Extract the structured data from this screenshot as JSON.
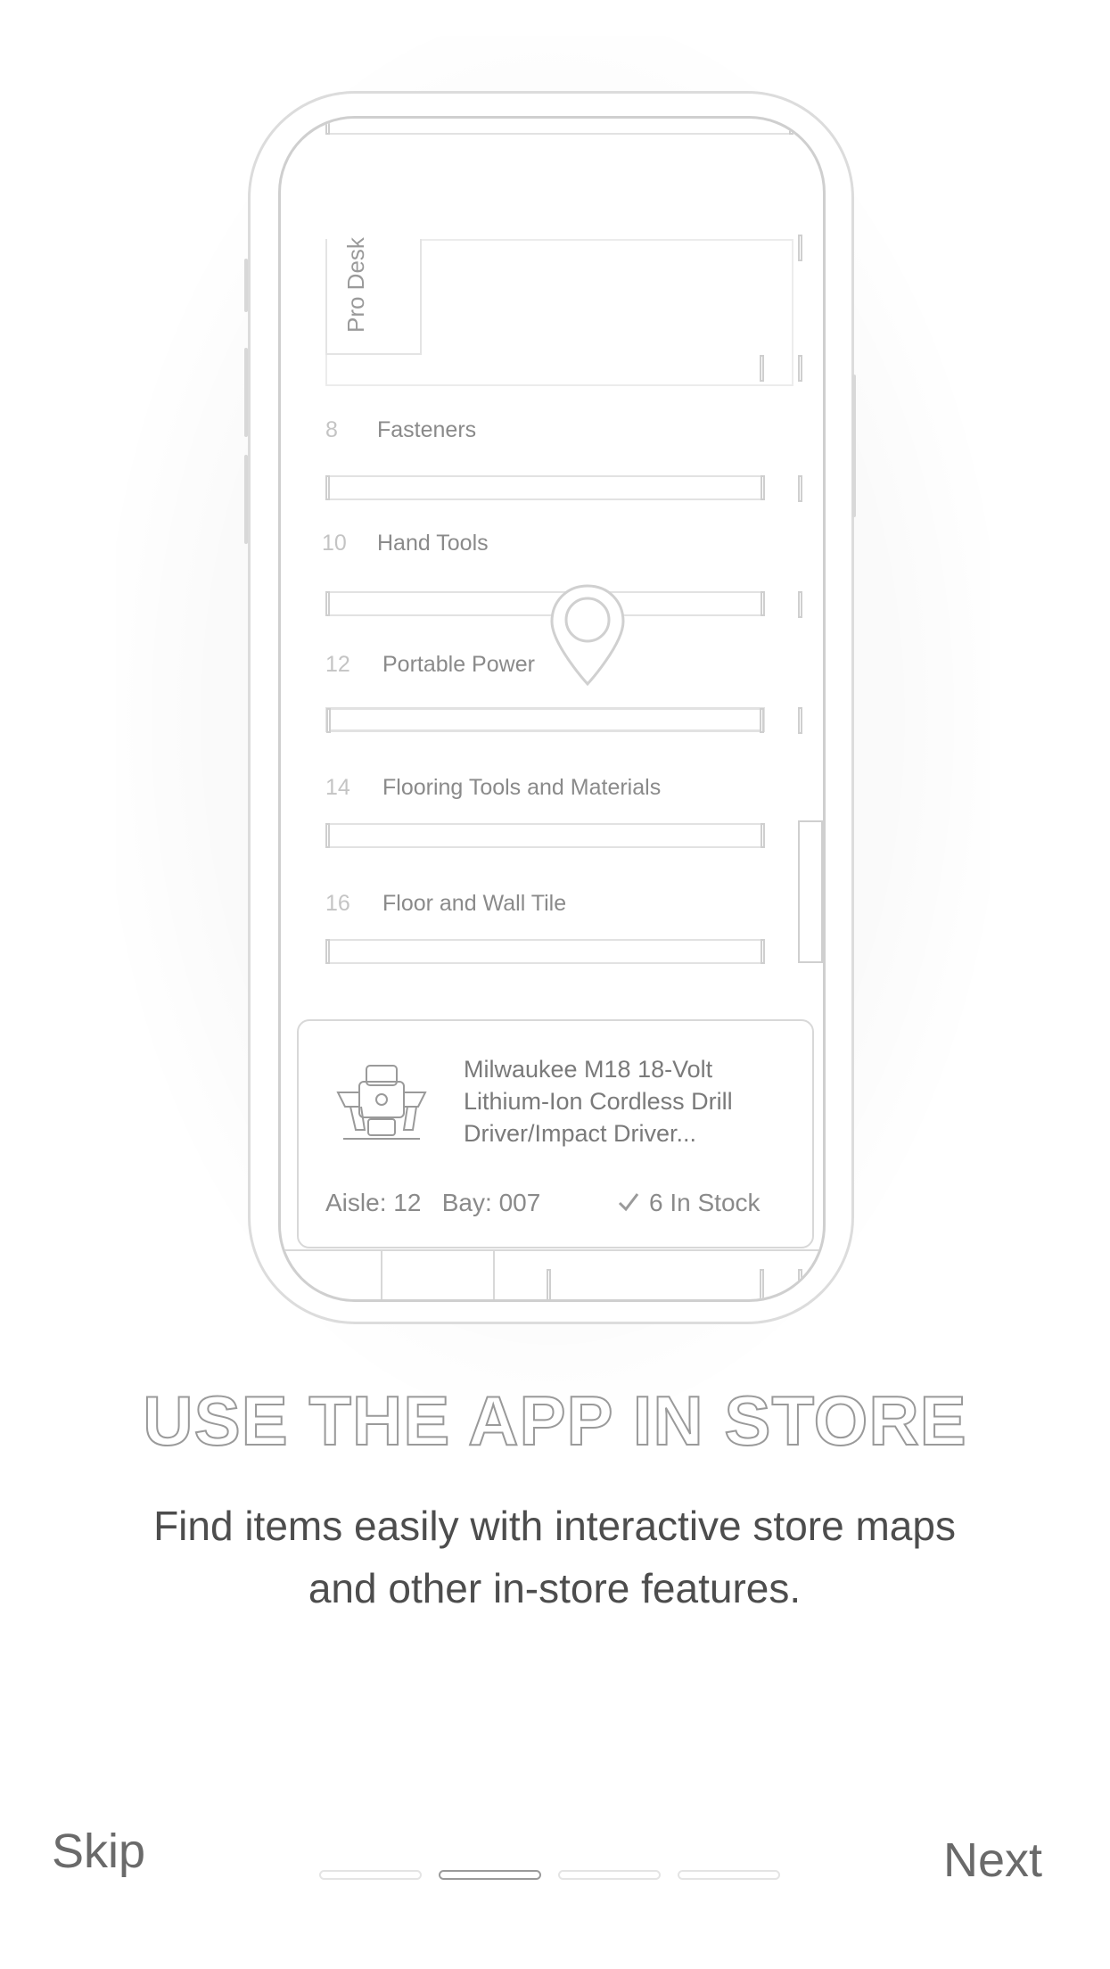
{
  "illustration": {
    "pro_desk_label": "Pro Desk",
    "aisles": [
      {
        "number": "8",
        "label": "Fasteners"
      },
      {
        "number": "10",
        "label": "Hand Tools"
      },
      {
        "number": "12",
        "label": "Portable Power"
      },
      {
        "number": "14",
        "label": "Flooring Tools and Materials"
      },
      {
        "number": "16",
        "label": "Floor and Wall Tile"
      }
    ],
    "product_card": {
      "title": "Milwaukee  M18 18-Volt Lithium-Ion Cordless Drill Driver/Impact Driver...",
      "aisle_label": "Aisle:",
      "aisle_value": "12",
      "bay_label": "Bay:",
      "bay_value": "007",
      "stock": "6 In Stock"
    },
    "icons": {
      "pin": "map-pin-icon",
      "check": "check-icon",
      "product": "drill-kit-image"
    }
  },
  "heading": "USE THE APP IN STORE",
  "description": "Find items easily with interactive store maps and other in-store features.",
  "nav": {
    "skip_label": "Skip",
    "next_label": "Next",
    "page_count": 4,
    "current_page": 2
  }
}
